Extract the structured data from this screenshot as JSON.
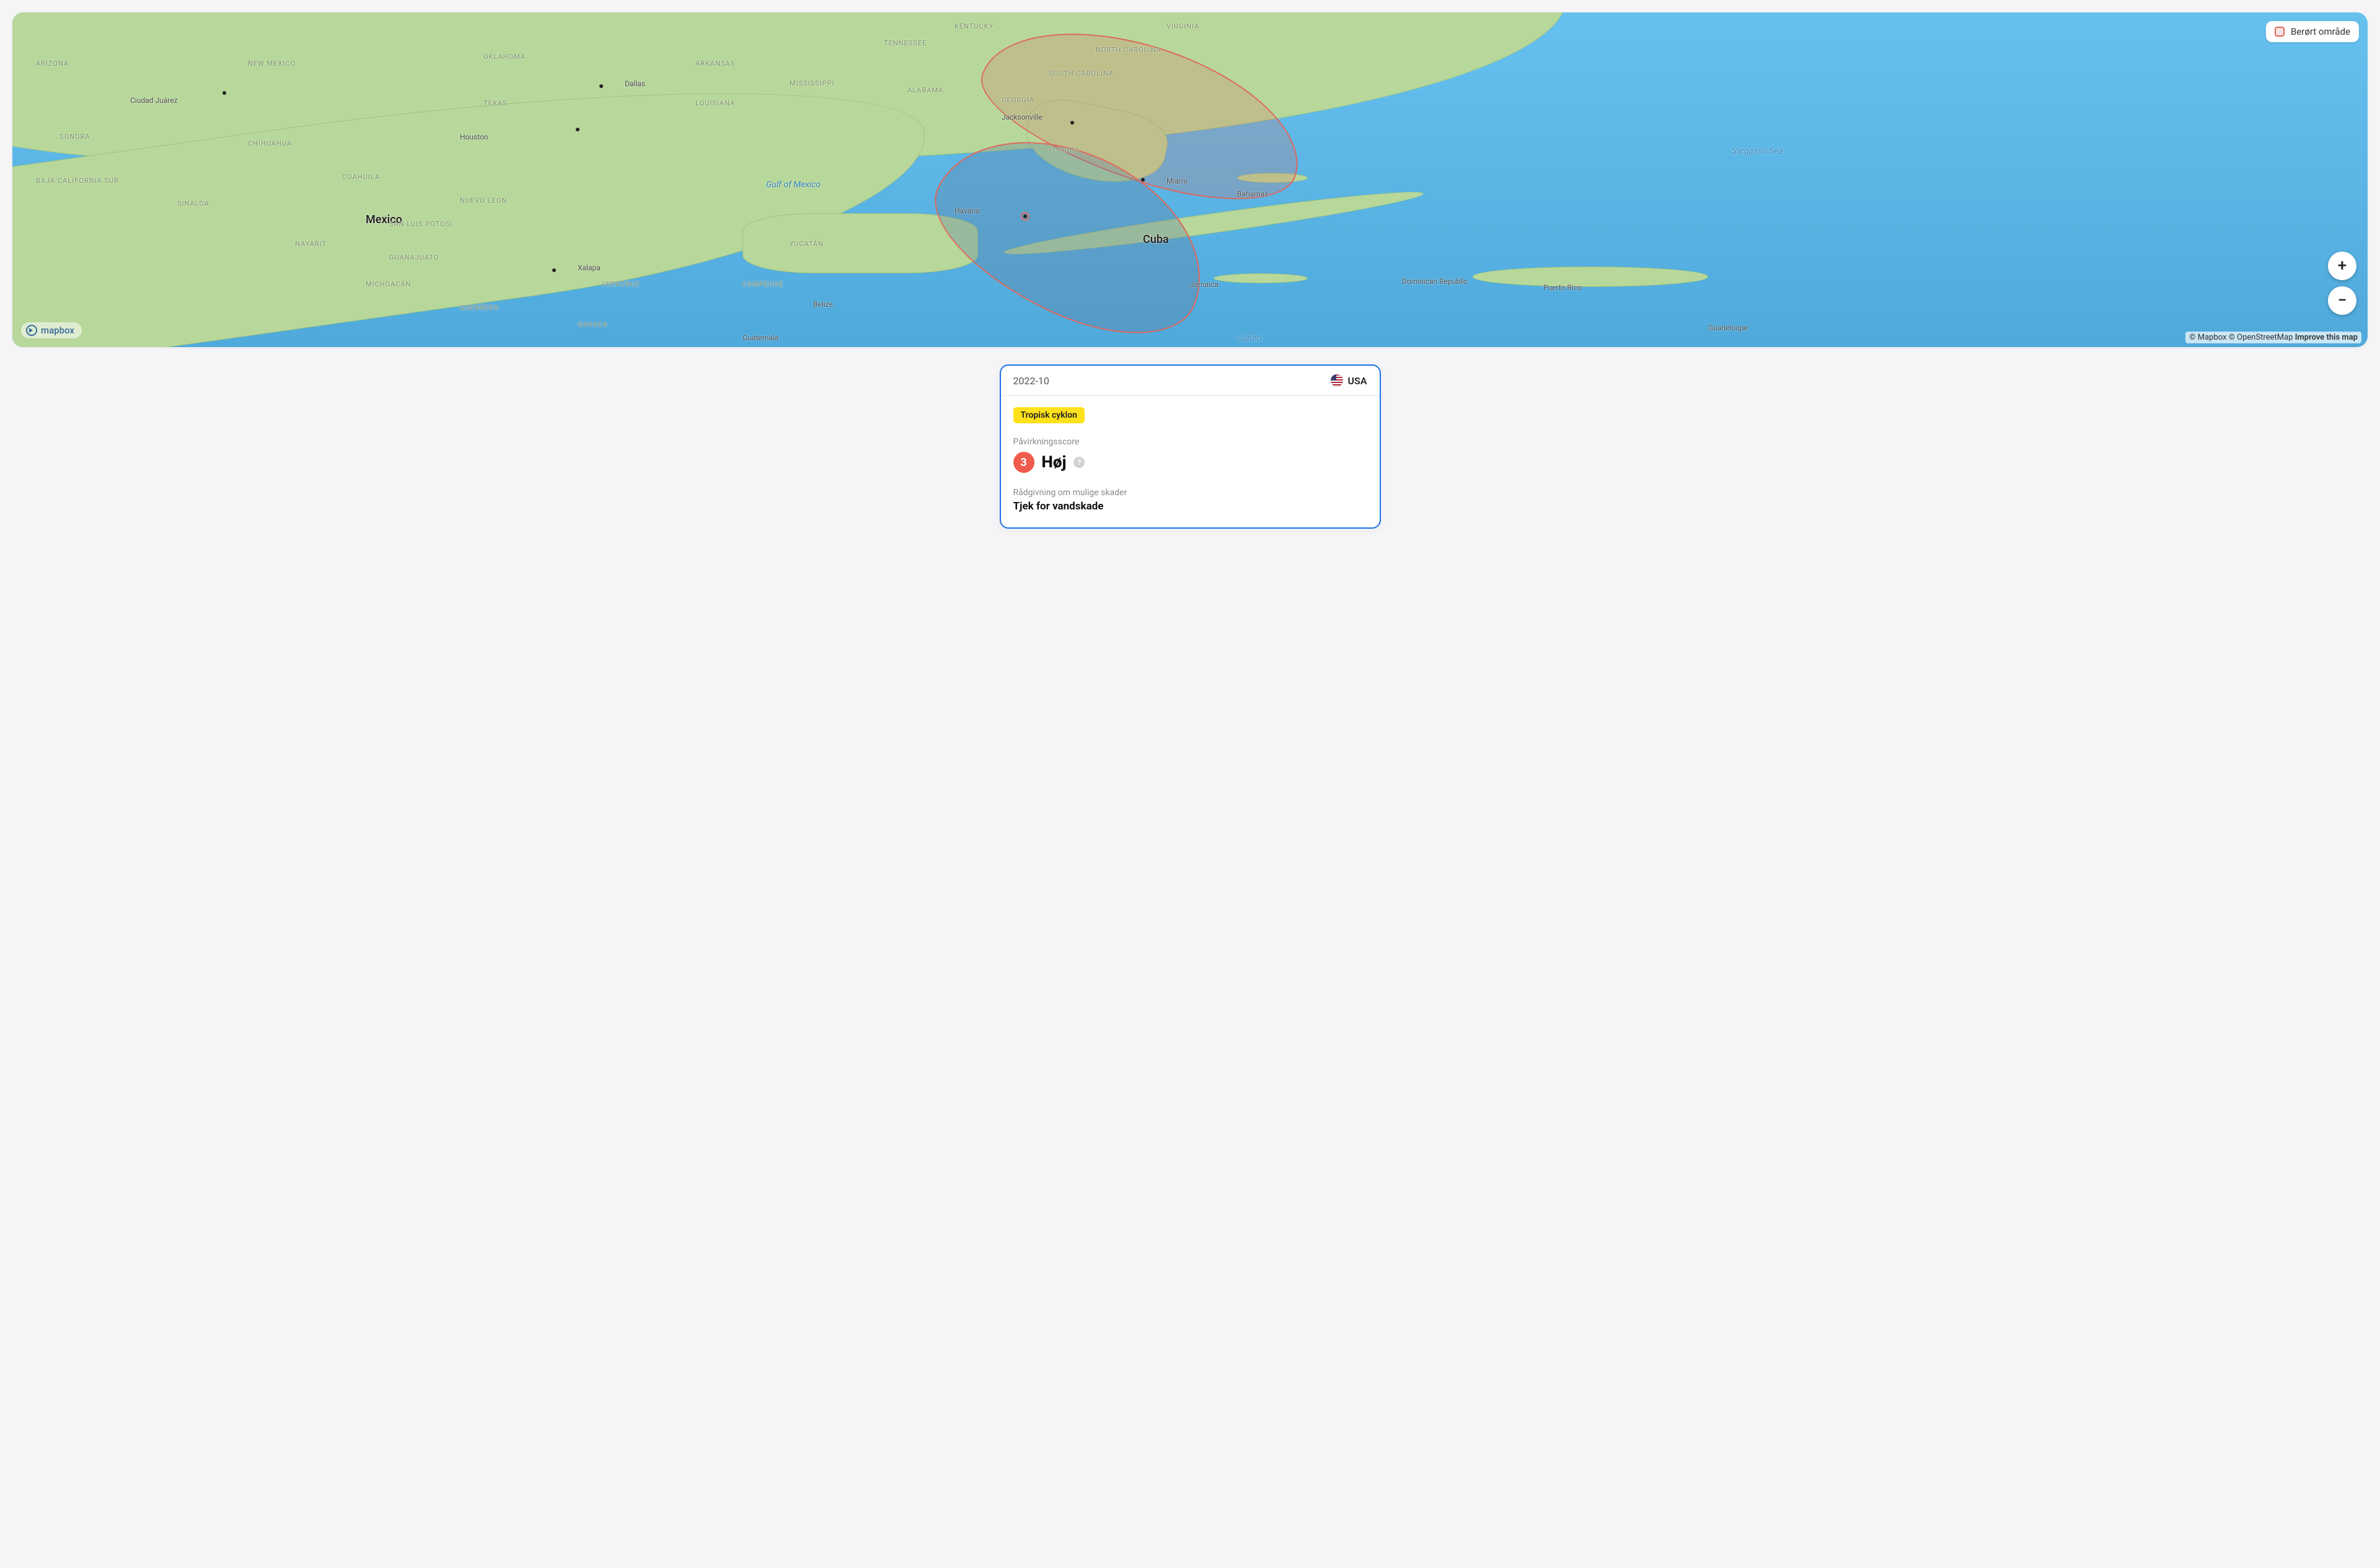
{
  "map": {
    "legend_label": "Berørt område",
    "zoom_in": "+",
    "zoom_out": "−",
    "brand": "mapbox",
    "attribution": {
      "mapbox": "© Mapbox",
      "osm": "© OpenStreetMap",
      "improve": "Improve this map"
    },
    "labels": {
      "countries": {
        "mexico": "Mexico",
        "cuba": "Cuba"
      },
      "states": {
        "arizona": "ARIZONA",
        "new_mexico": "NEW MEXICO",
        "oklahoma": "OKLAHOMA",
        "texas": "TEXAS",
        "arkansas": "ARKANSAS",
        "louisiana": "LOUISIANA",
        "mississippi": "MISSISSIPPI",
        "alabama": "ALABAMA",
        "tennessee": "TENNESSEE",
        "kentucky": "KENTUCKY",
        "virginia": "VIRGINIA",
        "north_carolina": "NORTH CAROLINA",
        "south_carolina": "SOUTH CAROLINA",
        "georgia": "GEORGIA",
        "florida": "FLORIDA",
        "sonora": "SONORA",
        "chihuahua": "CHIHUAHUA",
        "coahuila": "COAHUILA",
        "sinaloa": "SINALOA",
        "nuevo_leon": "NUEVO LEON",
        "san_luis_potosi": "SAN LUIS POTOSI",
        "nayarit": "NAYARIT",
        "guanajuato": "GUANAJUATO",
        "michoacan": "MICHOACÁN",
        "veracruz": "VERACRUZ",
        "guerrero": "GUERRERO",
        "oaxaca": "OAXACA",
        "campeche": "CAMPECHE",
        "yucatan": "YUCATÁN",
        "baja_sur": "BAJA CALIFORNIA SUR"
      },
      "cities": {
        "ciudad_juarez": "Ciudad Juárez",
        "dallas": "Dallas",
        "houston": "Houston",
        "jacksonville": "Jacksonville",
        "miami": "Miami",
        "havana": "Havana",
        "xalapa": "Xalapa",
        "belize": "Belize",
        "guatemala": "Guatemala"
      },
      "islands": {
        "bahamas": "Bahamas",
        "jamaica": "Jamaica",
        "dominican_republic": "Dominican Republic",
        "puerto_rico": "Puerto Rico",
        "guadeloupe": "Guadeloupe"
      },
      "water": {
        "gulf": "Gulf of Mexico",
        "sargasso": "Sargasso Sea",
        "carib": "Caribb"
      }
    }
  },
  "card": {
    "date": "2022-10",
    "country": "USA",
    "event_tag": "Tropisk cyklon",
    "impact": {
      "label": "Påvirkningsscore",
      "score": "3",
      "level": "Høj",
      "help": "?"
    },
    "advice": {
      "label": "Rådgivning om mulige skader",
      "text": "Tjek for vandskade"
    }
  }
}
